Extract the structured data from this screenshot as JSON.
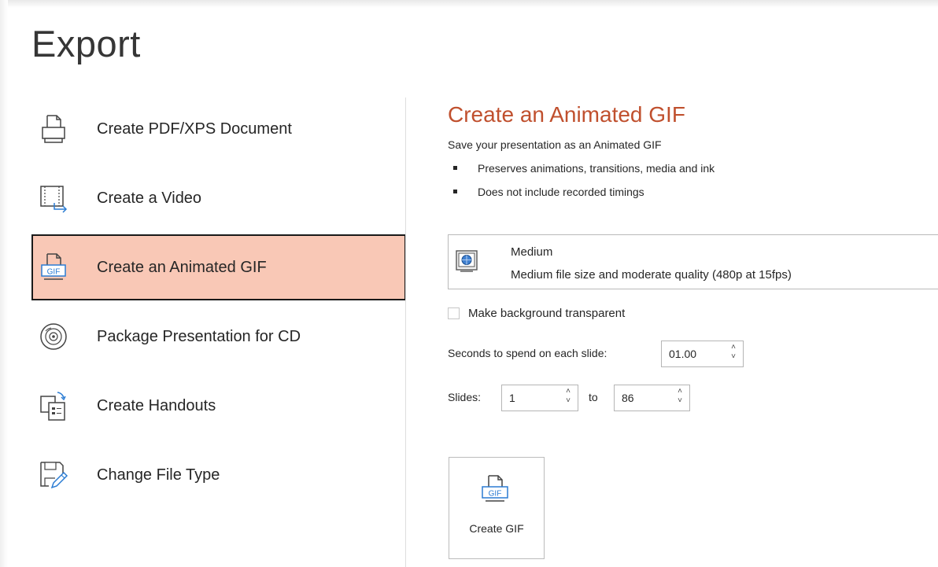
{
  "page": {
    "title": "Export"
  },
  "nav": {
    "items": [
      {
        "label": "Create PDF/XPS Document",
        "icon": "pdf-document-icon"
      },
      {
        "label": "Create a Video",
        "icon": "video-icon"
      },
      {
        "label": "Create an Animated GIF",
        "icon": "gif-icon",
        "selected": true
      },
      {
        "label": "Package Presentation for CD",
        "icon": "cd-icon"
      },
      {
        "label": "Create Handouts",
        "icon": "handouts-icon"
      },
      {
        "label": "Change File Type",
        "icon": "change-file-type-icon"
      }
    ]
  },
  "pane": {
    "title": "Create an Animated GIF",
    "description": "Save your presentation as an Animated GIF",
    "bullets": [
      "Preserves animations, transitions, media and ink",
      "Does not include recorded timings"
    ],
    "quality": {
      "name": "Medium",
      "description": "Medium file size and moderate quality (480p at 15fps)",
      "icon": "quality-monitor-icon"
    },
    "transparent_label": "Make background transparent",
    "transparent_checked": false,
    "seconds_label": "Seconds to spend on each slide:",
    "seconds_value": "01.00",
    "slides_label": "Slides:",
    "slides_from": "1",
    "to_label": "to",
    "slides_to": "86",
    "create_button": {
      "label": "Create GIF",
      "text_on_icon": "GIF"
    },
    "spin_up": "˄",
    "spin_down": "˅"
  },
  "colors": {
    "accent_title": "#c0502e",
    "selected_bg": "#f9c8b6",
    "selected_border": "#1a1a1a"
  }
}
